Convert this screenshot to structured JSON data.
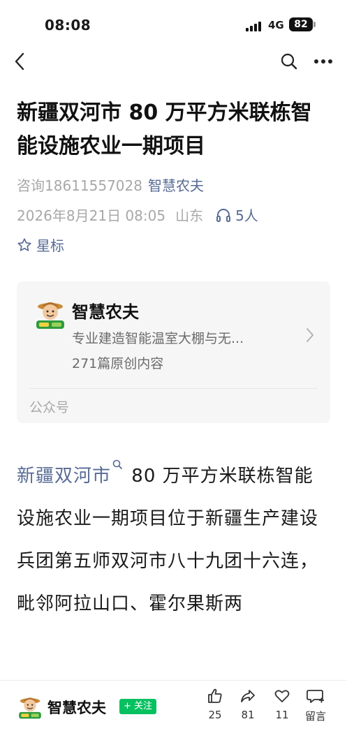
{
  "status_bar": {
    "time": "08:08",
    "network": "4G",
    "battery": "82"
  },
  "article": {
    "title": "新疆双河市 80 万平方米联栋智能设施农业一期项目",
    "contact_label": "咨询18611557028",
    "account_link": "智慧农夫",
    "datetime": "2026年8月21日 08:05",
    "location": "山东",
    "listeners": "5人",
    "star_label": "星标",
    "body_link": "新疆双河市",
    "body_text": " 80 万平方米联栋智能设施农业一期项目位于新疆生产建设兵团第五师双河市八十九团十六连，毗邻阿拉山口、霍尔果斯两"
  },
  "account_card": {
    "name": "智慧农夫",
    "description": "专业建造智能温室大棚与无...",
    "articles_count": "271篇原创内容",
    "type_label": "公众号"
  },
  "bottom_bar": {
    "name": "智慧农夫",
    "follow_label": "+ 关注",
    "likes": "25",
    "shares": "81",
    "favorites": "11",
    "comment_label": "留言"
  },
  "icons": {
    "back": "chevron-left-icon",
    "search": "search-icon",
    "more": "more-dots-icon",
    "star": "star-outline-icon",
    "headphones": "headphones-icon",
    "like": "thumbs-up-icon",
    "share": "share-arrow-icon",
    "favorite": "heart-icon",
    "comment": "comment-plus-icon"
  },
  "colors": {
    "link": "#576b95",
    "follow": "#07c160",
    "meta": "#a8a8a8",
    "card_bg": "#f6f6f6"
  }
}
